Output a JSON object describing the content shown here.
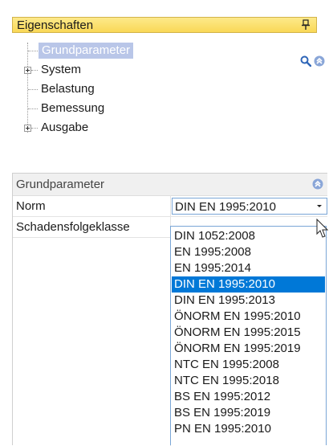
{
  "panel": {
    "title": "Eigenschaften"
  },
  "tree": {
    "items": [
      {
        "label": "Grundparameter"
      },
      {
        "label": "System"
      },
      {
        "label": "Belastung"
      },
      {
        "label": "Bemessung"
      },
      {
        "label": "Ausgabe"
      }
    ]
  },
  "grid": {
    "category": "Grundparameter",
    "rows": [
      {
        "label": "Norm",
        "value": "DIN EN 1995:2010"
      },
      {
        "label": "Schadensfolgeklasse"
      }
    ]
  },
  "dropdown": {
    "selected": "DIN EN 1995:2010",
    "options": [
      "DIN 1052:2008",
      "EN 1995:2008",
      "EN 1995:2014",
      "DIN EN 1995:2010",
      "DIN EN 1995:2013",
      "ÖNORM EN 1995:2010",
      "ÖNORM EN 1995:2015",
      "ÖNORM EN 1995:2019",
      "NTC EN 1995:2008",
      "NTC EN 1995:2018",
      "BS EN 1995:2012",
      "BS EN 1995:2019",
      "PN EN 1995:2010"
    ]
  },
  "colors": {
    "header_yellow": "#f9d857",
    "selection_blue": "#0078d7",
    "tree_selection": "#b9c6e8"
  }
}
